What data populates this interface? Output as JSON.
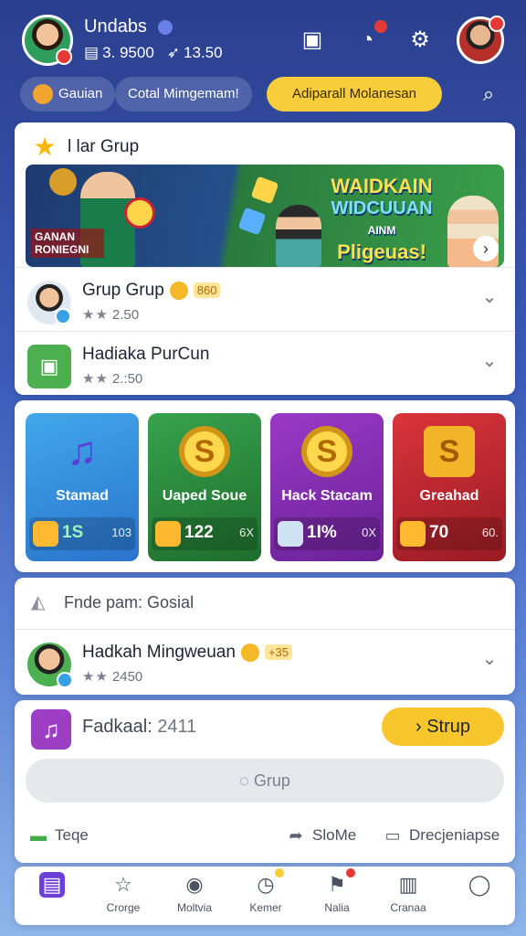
{
  "header": {
    "username": "Undabs",
    "balance": "3. 9500",
    "secondary": "13.50"
  },
  "filters": {
    "chip1": "Gauian",
    "chip2": "Cotal Mimgemam!",
    "chip3": "Adiparall Molanesan"
  },
  "card1": {
    "title": "l lar Grup",
    "banner": {
      "left_text": "GANAN RONIEGNI",
      "line1": "WAIDKAIN",
      "line2": "WIDCUUAN",
      "line3": "AINM",
      "line4": "Pligeuas!"
    },
    "rows": [
      {
        "name": "Grup Grup",
        "tag": "860",
        "rating": "2.50"
      },
      {
        "name": "Hadiaka PurCun",
        "rating": "2.:50"
      }
    ]
  },
  "tiles": [
    {
      "label": "Stamad",
      "value": "1S",
      "extra": "103"
    },
    {
      "label": "Uaped Soue",
      "value": "122",
      "extra": "6X"
    },
    {
      "label": "Hack Stacam",
      "value": "1I%",
      "extra": "0X"
    },
    {
      "label": "Greahad",
      "value": "70",
      "extra": "60."
    }
  ],
  "card3": {
    "head": "Fnde pam: Gosial",
    "row": {
      "name": "Hadkah Mingweuan",
      "tag": "+35",
      "rating": "2450"
    }
  },
  "card4": {
    "label": "Fadkaal:",
    "value": "2411",
    "stup": "Strup",
    "grup": "Grup",
    "left": "Teqe",
    "mid": "SloMe",
    "right": "Drecjeniapse"
  },
  "nav": [
    {
      "label": ""
    },
    {
      "label": "Crorge"
    },
    {
      "label": "Moltvia"
    },
    {
      "label": "Kemer"
    },
    {
      "label": "Nalia"
    },
    {
      "label": "Cranaa"
    },
    {
      "label": ""
    }
  ],
  "colors": {
    "accent": "#f7c52c",
    "brand": "#6c3fd8"
  }
}
